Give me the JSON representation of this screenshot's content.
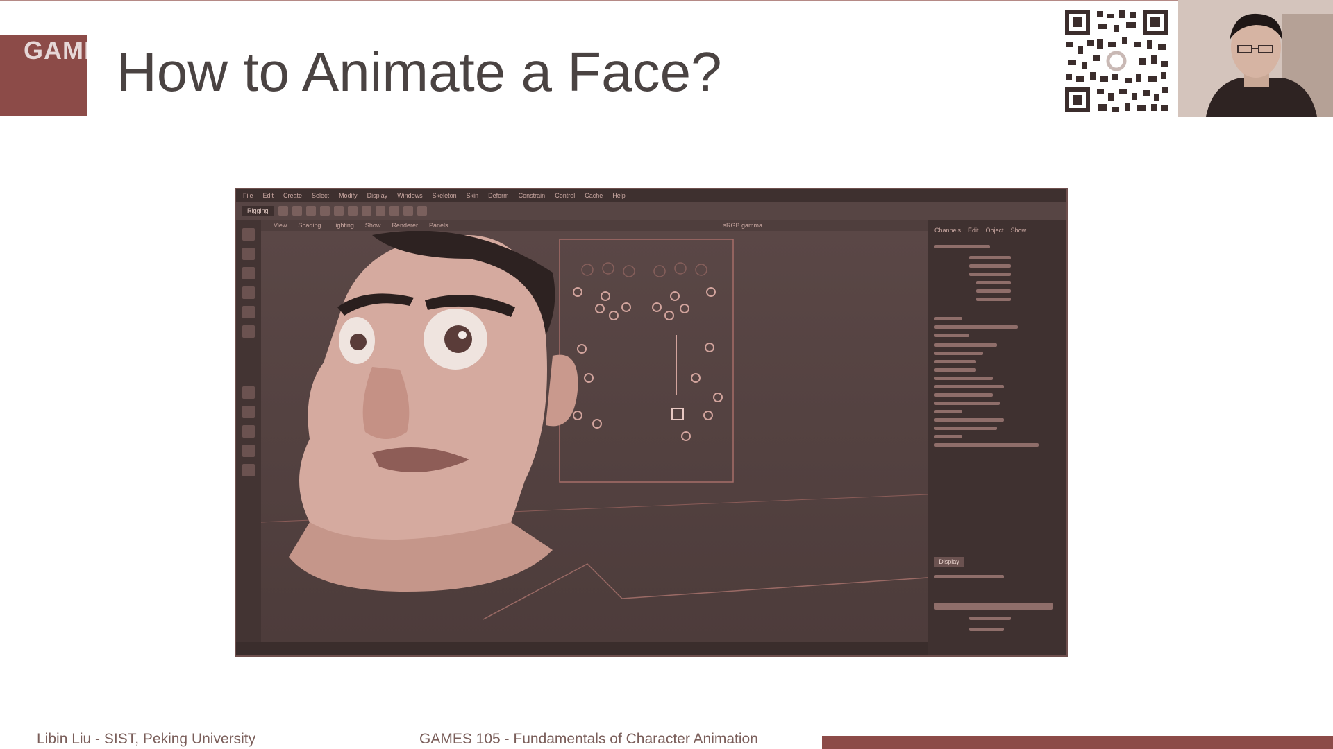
{
  "slide": {
    "title": "How to Animate a Face?",
    "watermark": "GAMES Webinar",
    "footer_left": "Libin Liu - SIST, Peking University",
    "footer_center": "GAMES 105 - Fundamentals of Character Animation"
  },
  "app": {
    "menu": [
      "File",
      "Edit",
      "Create",
      "Select",
      "Modify",
      "Display",
      "Windows",
      "Skeleton",
      "Skin",
      "Deform",
      "Constrain",
      "Control",
      "Cache",
      "Help"
    ],
    "mode": "Rigging",
    "panel_menu": [
      "View",
      "Shading",
      "Lighting",
      "Show",
      "Renderer",
      "Panels"
    ],
    "color_space": "sRGB gamma",
    "channel_tabs": [
      "Channels",
      "Edit",
      "Object",
      "Show"
    ],
    "display_tab": "Display"
  },
  "colors": {
    "accent": "#8c4b48",
    "title_text": "#4a4342",
    "footer_text": "#7a5e5a"
  }
}
